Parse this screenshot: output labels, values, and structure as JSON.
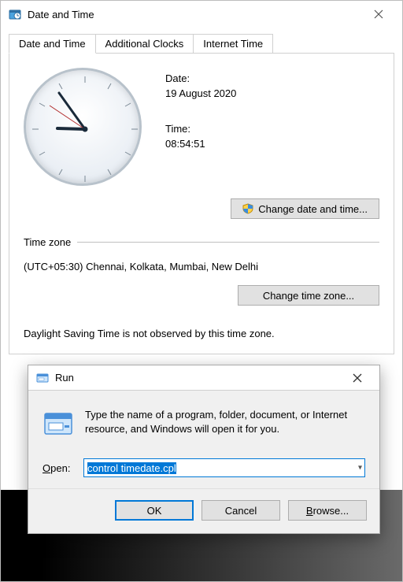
{
  "window": {
    "title": "Date and Time"
  },
  "tabs": {
    "t0": "Date and Time",
    "t1": "Additional Clocks",
    "t2": "Internet Time"
  },
  "dt": {
    "date_label": "Date:",
    "date_value": "19 August 2020",
    "time_label": "Time:",
    "time_value": "08:54:51",
    "change_dt_btn": "Change date and time..."
  },
  "tz": {
    "section_label": "Time zone",
    "value": "(UTC+05:30) Chennai, Kolkata, Mumbai, New Delhi",
    "change_tz_btn": "Change time zone..."
  },
  "dst": {
    "text": "Daylight Saving Time is not observed by this time zone."
  },
  "run": {
    "title": "Run",
    "description": "Type the name of a program, folder, document, or Internet resource, and Windows will open it for you.",
    "open_label_prefix": "O",
    "open_label_rest": "pen:",
    "input_value": "control timedate.cpl",
    "ok": "OK",
    "cancel": "Cancel",
    "browse": "Browse...",
    "browse_underline": "B"
  }
}
